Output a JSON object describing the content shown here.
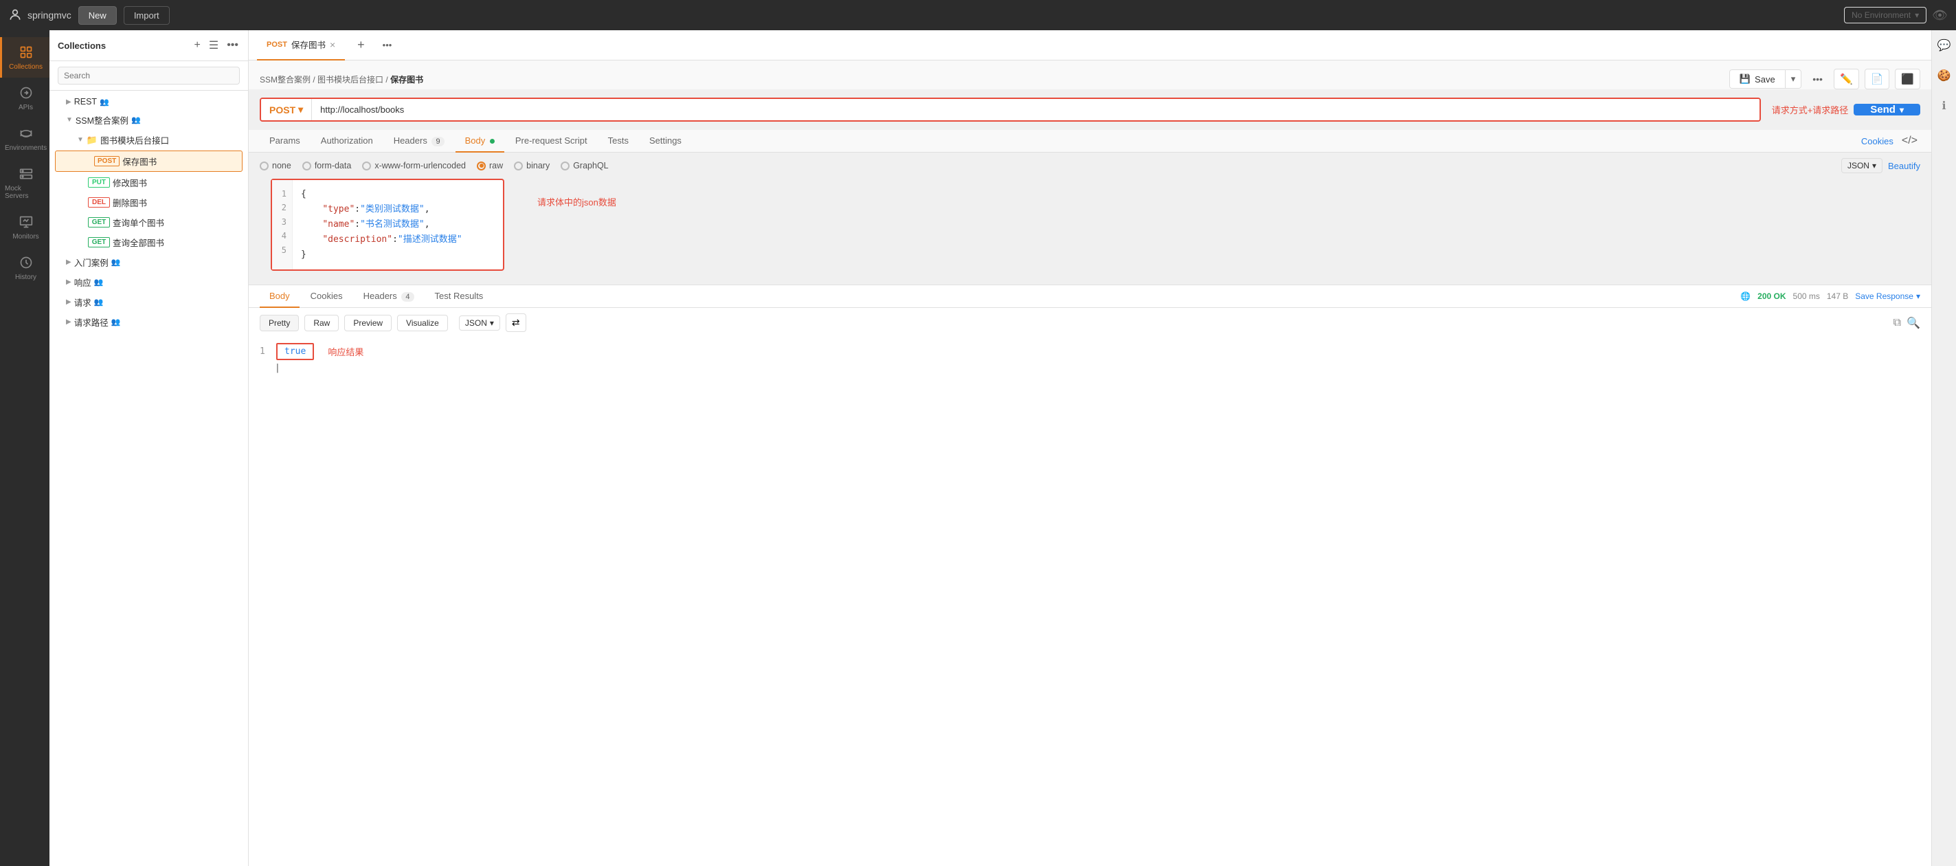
{
  "app": {
    "name": "springmvc",
    "new_label": "New",
    "import_label": "Import",
    "env_placeholder": "No Environment"
  },
  "sidebar": {
    "collections_label": "Collections",
    "apis_label": "APIs",
    "environments_label": "Environments",
    "mock_servers_label": "Mock Servers",
    "monitors_label": "Monitors",
    "history_label": "History"
  },
  "collections_panel": {
    "title": "Collections",
    "tree": [
      {
        "id": "rest",
        "label": "REST",
        "level": 1,
        "type": "collection",
        "chevron": "▶"
      },
      {
        "id": "ssm",
        "label": "SSM整合案例",
        "level": 1,
        "type": "collection",
        "chevron": "▼"
      },
      {
        "id": "books-folder",
        "label": "图书模块后台接口",
        "level": 2,
        "type": "folder",
        "chevron": "▼"
      },
      {
        "id": "save-book",
        "label": "保存图书",
        "level": 3,
        "type": "request",
        "method": "POST",
        "active": true
      },
      {
        "id": "edit-book",
        "label": "修改图书",
        "level": 3,
        "type": "request",
        "method": "PUT"
      },
      {
        "id": "delete-book",
        "label": "删除图书",
        "level": 3,
        "type": "request",
        "method": "DEL"
      },
      {
        "id": "get-book",
        "label": "查询单个图书",
        "level": 3,
        "type": "request",
        "method": "GET"
      },
      {
        "id": "get-all-books",
        "label": "查询全部图书",
        "level": 3,
        "type": "request",
        "method": "GET"
      },
      {
        "id": "intro",
        "label": "入门案例",
        "level": 1,
        "type": "collection",
        "chevron": "▶"
      },
      {
        "id": "response",
        "label": "响应",
        "level": 1,
        "type": "collection",
        "chevron": "▶"
      },
      {
        "id": "request",
        "label": "请求",
        "level": 1,
        "type": "collection",
        "chevron": "▶"
      },
      {
        "id": "request-path",
        "label": "请求路径",
        "level": 1,
        "type": "collection",
        "chevron": "▶"
      }
    ]
  },
  "tabs": [
    {
      "id": "save-book-tab",
      "method": "POST",
      "label": "保存图书",
      "active": true
    }
  ],
  "breadcrumb": {
    "parts": [
      "SSM整合案例",
      "图书模块后台接口",
      "保存图书"
    ],
    "separator": "/"
  },
  "url_bar": {
    "method": "POST",
    "url": "http://localhost/books",
    "annotation": "请求方式+请求路径",
    "send_label": "Send"
  },
  "request_tabs": {
    "params": "Params",
    "authorization": "Authorization",
    "headers": "Headers",
    "headers_count": "9",
    "body": "Body",
    "pre_request": "Pre-request Script",
    "tests": "Tests",
    "settings": "Settings",
    "cookies_link": "Cookies",
    "active": "Body"
  },
  "body_options": {
    "none": "none",
    "form_data": "form-data",
    "url_encoded": "x-www-form-urlencoded",
    "raw": "raw",
    "binary": "binary",
    "graphql": "GraphQL",
    "active": "raw",
    "format": "JSON",
    "beautify": "Beautify",
    "annotation": "请求体中的json数据"
  },
  "code_editor": {
    "lines": [
      {
        "num": "1",
        "text": "{"
      },
      {
        "num": "2",
        "text": "    \"type\":\"类别测试数据\","
      },
      {
        "num": "3",
        "text": "    \"name\":\"书名测试数据\","
      },
      {
        "num": "4",
        "text": "    \"description\":\"描述测试数据\""
      },
      {
        "num": "5",
        "text": "}"
      }
    ]
  },
  "response": {
    "tabs": {
      "body": "Body",
      "cookies": "Cookies",
      "headers": "Headers",
      "headers_count": "4",
      "test_results": "Test Results",
      "active": "Body"
    },
    "status": "200 OK",
    "time": "500 ms",
    "size": "147 B",
    "save_response": "Save Response",
    "format_tabs": {
      "pretty": "Pretty",
      "raw": "Raw",
      "preview": "Preview",
      "visualize": "Visualize",
      "active": "Pretty"
    },
    "format": "JSON",
    "value": "true",
    "annotation": "响应结果",
    "line_num": "1"
  }
}
